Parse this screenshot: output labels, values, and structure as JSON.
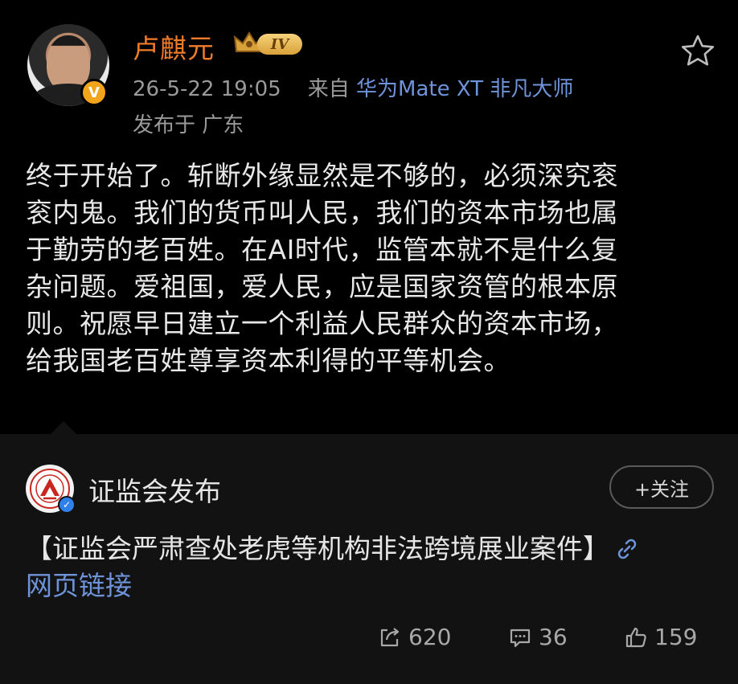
{
  "post": {
    "author": {
      "name": "卢麒元",
      "level": "IV",
      "verified_mark": "V",
      "avatar_icon": "avatar-photo"
    },
    "time": "26-5-22 19:05",
    "source_prefix": "来自",
    "source": "华为Mate XT 非凡大师",
    "location": "发布于 广东",
    "content_lines": [
      "终于开始了。斩断外缘显然是不够的，必须深究衮",
      "衮内鬼。我们的货币叫人民，我们的资本市场也属",
      "于勤劳的老百姓。在AI时代，监管本就不是什么复",
      "杂问题。爱祖国，爱人民，应是国家资管的根本原",
      "则。祝愿早日建立一个利益人民群众的资本市场，",
      "给我国老百姓尊享资本利得的平等机会。"
    ],
    "star_icon": "star-icon"
  },
  "repost": {
    "org_name": "证监会发布",
    "follow_label": "+关注",
    "headline": "【证监会严肃查处老虎等机构非法跨境展业案件】",
    "link_label": "网页链接",
    "link_icon": "link-icon"
  },
  "actions": {
    "reposts": "620",
    "comments": "36",
    "likes": "159"
  },
  "colors": {
    "background": "#000000",
    "card_background": "#121212",
    "username": "#F07C2A",
    "link": "#6E93D8",
    "meta": "#9A9A9A",
    "verified_badge": "#F2A51A"
  }
}
